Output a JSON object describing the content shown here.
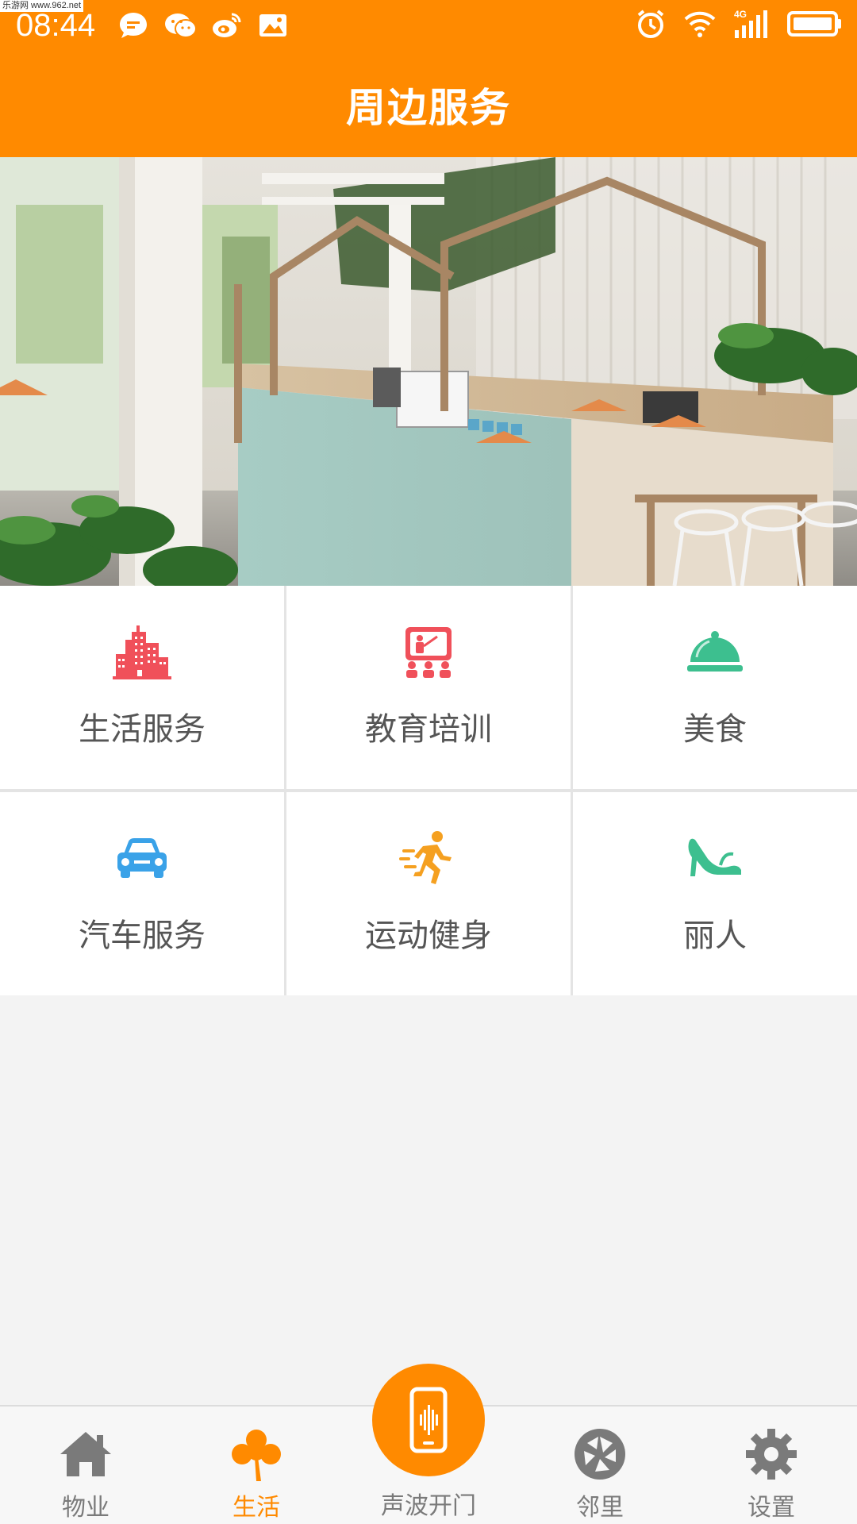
{
  "status_bar": {
    "time": "08:44",
    "watermark": "乐游网 www.962.net",
    "left_icons": [
      "chat-bubble-icon",
      "wechat-icon",
      "weibo-icon",
      "image-icon"
    ],
    "right_icons": [
      "alarm-icon",
      "wifi-icon",
      "signal-4g-icon",
      "battery-icon"
    ],
    "network": "4G"
  },
  "header": {
    "title": "周边服务",
    "background_color": "#ff8a00"
  },
  "banner": {
    "image": "cafe-interior-photo"
  },
  "services": [
    {
      "label": "生活服务",
      "icon": "buildings-icon",
      "color": "#f0505a"
    },
    {
      "label": "教育培训",
      "icon": "classroom-icon",
      "color": "#f0505a"
    },
    {
      "label": "美食",
      "icon": "food-cloche-icon",
      "color": "#3dbf8f"
    },
    {
      "label": "汽车服务",
      "icon": "car-icon",
      "color": "#3aa2e8"
    },
    {
      "label": "运动健身",
      "icon": "running-icon",
      "color": "#f5a020"
    },
    {
      "label": "丽人",
      "icon": "high-heel-icon",
      "color": "#3dbf8f"
    }
  ],
  "bottom_nav": {
    "items": [
      {
        "label": "物业",
        "icon": "home-icon",
        "active": false
      },
      {
        "label": "生活",
        "icon": "clover-icon",
        "active": true
      },
      {
        "label": "声波开门",
        "icon": "phone-soundwave-icon",
        "active": false
      },
      {
        "label": "邻里",
        "icon": "aperture-icon",
        "active": false
      },
      {
        "label": "设置",
        "icon": "gear-icon",
        "active": false
      }
    ],
    "active_color": "#ff8a00",
    "inactive_color": "#7a7a7a"
  }
}
